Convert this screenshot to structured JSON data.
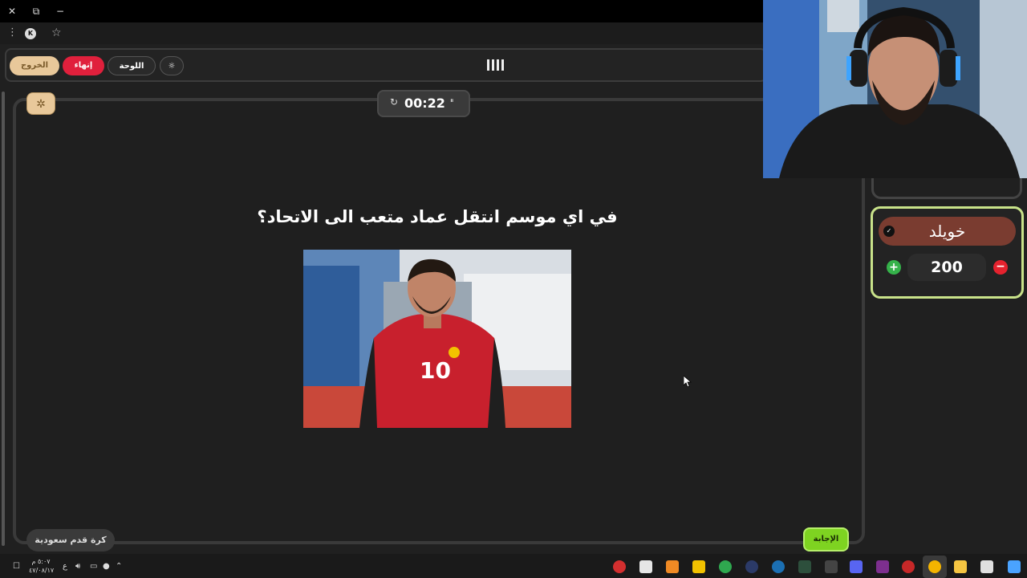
{
  "browser": {
    "close_glyph": "✕",
    "restore_glyph": "⧉",
    "minimize_glyph": "−",
    "menu_glyph": "⋮",
    "profile_letter": "K",
    "bookmark_glyph": "☆"
  },
  "toolbar": {
    "exit_label": "الخروج",
    "end_label": "إنهاء",
    "board_label": "اللوحة",
    "theme_glyph": "☼"
  },
  "timer": {
    "value": "00:22",
    "reset_glyph": "↻",
    "pause_glyph": "⏸"
  },
  "question": {
    "text": "في اي موسم انتقل عماد متعب الى الاتحاد؟",
    "category": "كرة قدم سعودية",
    "answer_label": "الإجابة",
    "bug_glyph": "✲"
  },
  "team": {
    "name": "خويلد",
    "score": "200",
    "plus_glyph": "+",
    "minus_glyph": "−",
    "check_glyph": "✓"
  },
  "taskbar": {
    "time": "٥:٠٧ م",
    "date": "٤٧/٠٨/١٧",
    "lang": "ع"
  },
  "colors": {
    "exit": "#e8c89a",
    "end": "#e0203c",
    "team_border": "#c9e38a",
    "team_name_bg": "#7a3c30",
    "answer": "#7ed321"
  }
}
